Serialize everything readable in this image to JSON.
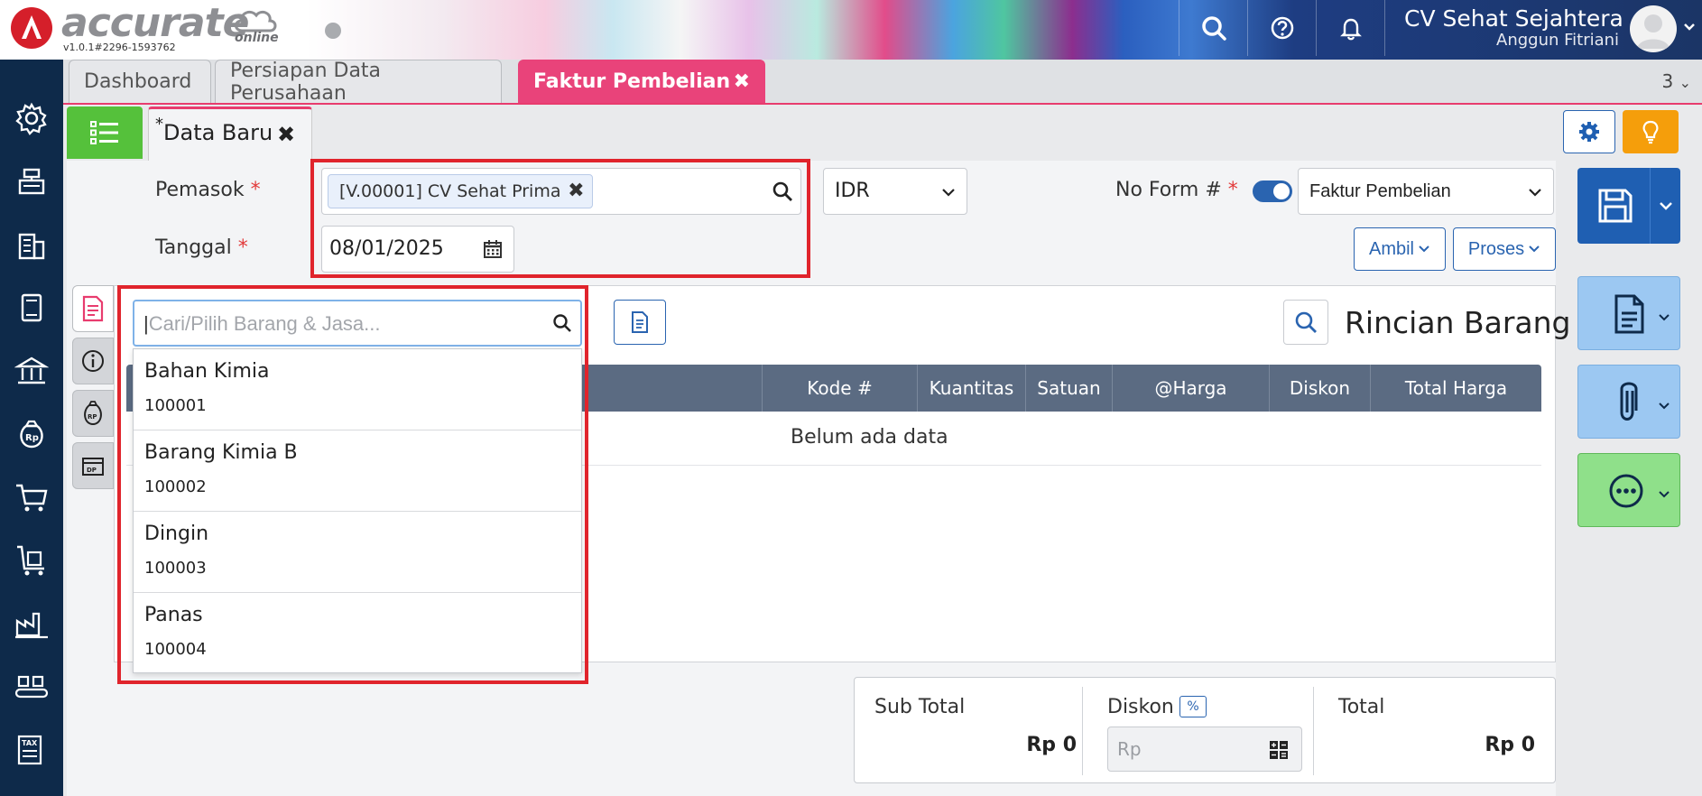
{
  "header": {
    "brand": "accurate",
    "brand_sub": "online",
    "version": "v1.0.1#2296-1593762",
    "company": "CV Sehat Sejahtera",
    "user": "Anggun Fitriani"
  },
  "module_tabs": [
    {
      "label": "Dashboard"
    },
    {
      "label": "Persiapan Data Perusahaan"
    },
    {
      "label": "Faktur Pembelian",
      "close": "✖"
    }
  ],
  "tab_count": "3",
  "form_tab": {
    "modified_marker": "*",
    "label": "Data Baru",
    "close": "✖"
  },
  "form": {
    "supplier_label": "Pemasok",
    "required_mark": "*",
    "supplier_value": "[V.00001] CV Sehat Prima",
    "currency": "IDR",
    "date_label": "Tanggal",
    "date_value": "08/01/2025",
    "no_form_label": "No Form #",
    "form_type": "Faktur Pembelian",
    "ambil_label": "Ambil",
    "proses_label": "Proses"
  },
  "item_search": {
    "placeholder": "Cari/Pilih Barang & Jasa...",
    "options": [
      {
        "name": "Bahan Kimia",
        "code": "100001"
      },
      {
        "name": "Barang Kimia B",
        "code": "100002"
      },
      {
        "name": "Dingin",
        "code": "100003"
      },
      {
        "name": "Panas",
        "code": "100004"
      }
    ]
  },
  "items_table": {
    "title": "Rincian Barang",
    "columns": [
      "Kode #",
      "Kuantitas",
      "Satuan",
      "@Harga",
      "Diskon",
      "Total Harga"
    ],
    "empty_text": "Belum ada data"
  },
  "totals": {
    "subtotal_label": "Sub Total",
    "subtotal_value": "Rp 0",
    "discount_label": "Diskon",
    "discount_pct": "%",
    "discount_placeholder": "Rp",
    "total_label": "Total",
    "total_value": "Rp 0"
  },
  "colors": {
    "accent_pink": "#e9437a",
    "nav_bg": "#0e2a4a",
    "primary_blue": "#1f5fb2",
    "highlight_red": "#e0242c",
    "list_green": "#55c13b",
    "tips_orange": "#f59e0b"
  },
  "icons": {
    "left_nav": [
      "gear-icon",
      "cash-register-icon",
      "building-icon",
      "book-icon",
      "bank-icon",
      "money-bag-icon",
      "cart-icon",
      "cart-box-icon",
      "factory-icon",
      "conveyor-icon",
      "tax-icon"
    ],
    "right_actions": [
      "save-icon",
      "document-icon",
      "paperclip-icon",
      "more-icon"
    ]
  }
}
